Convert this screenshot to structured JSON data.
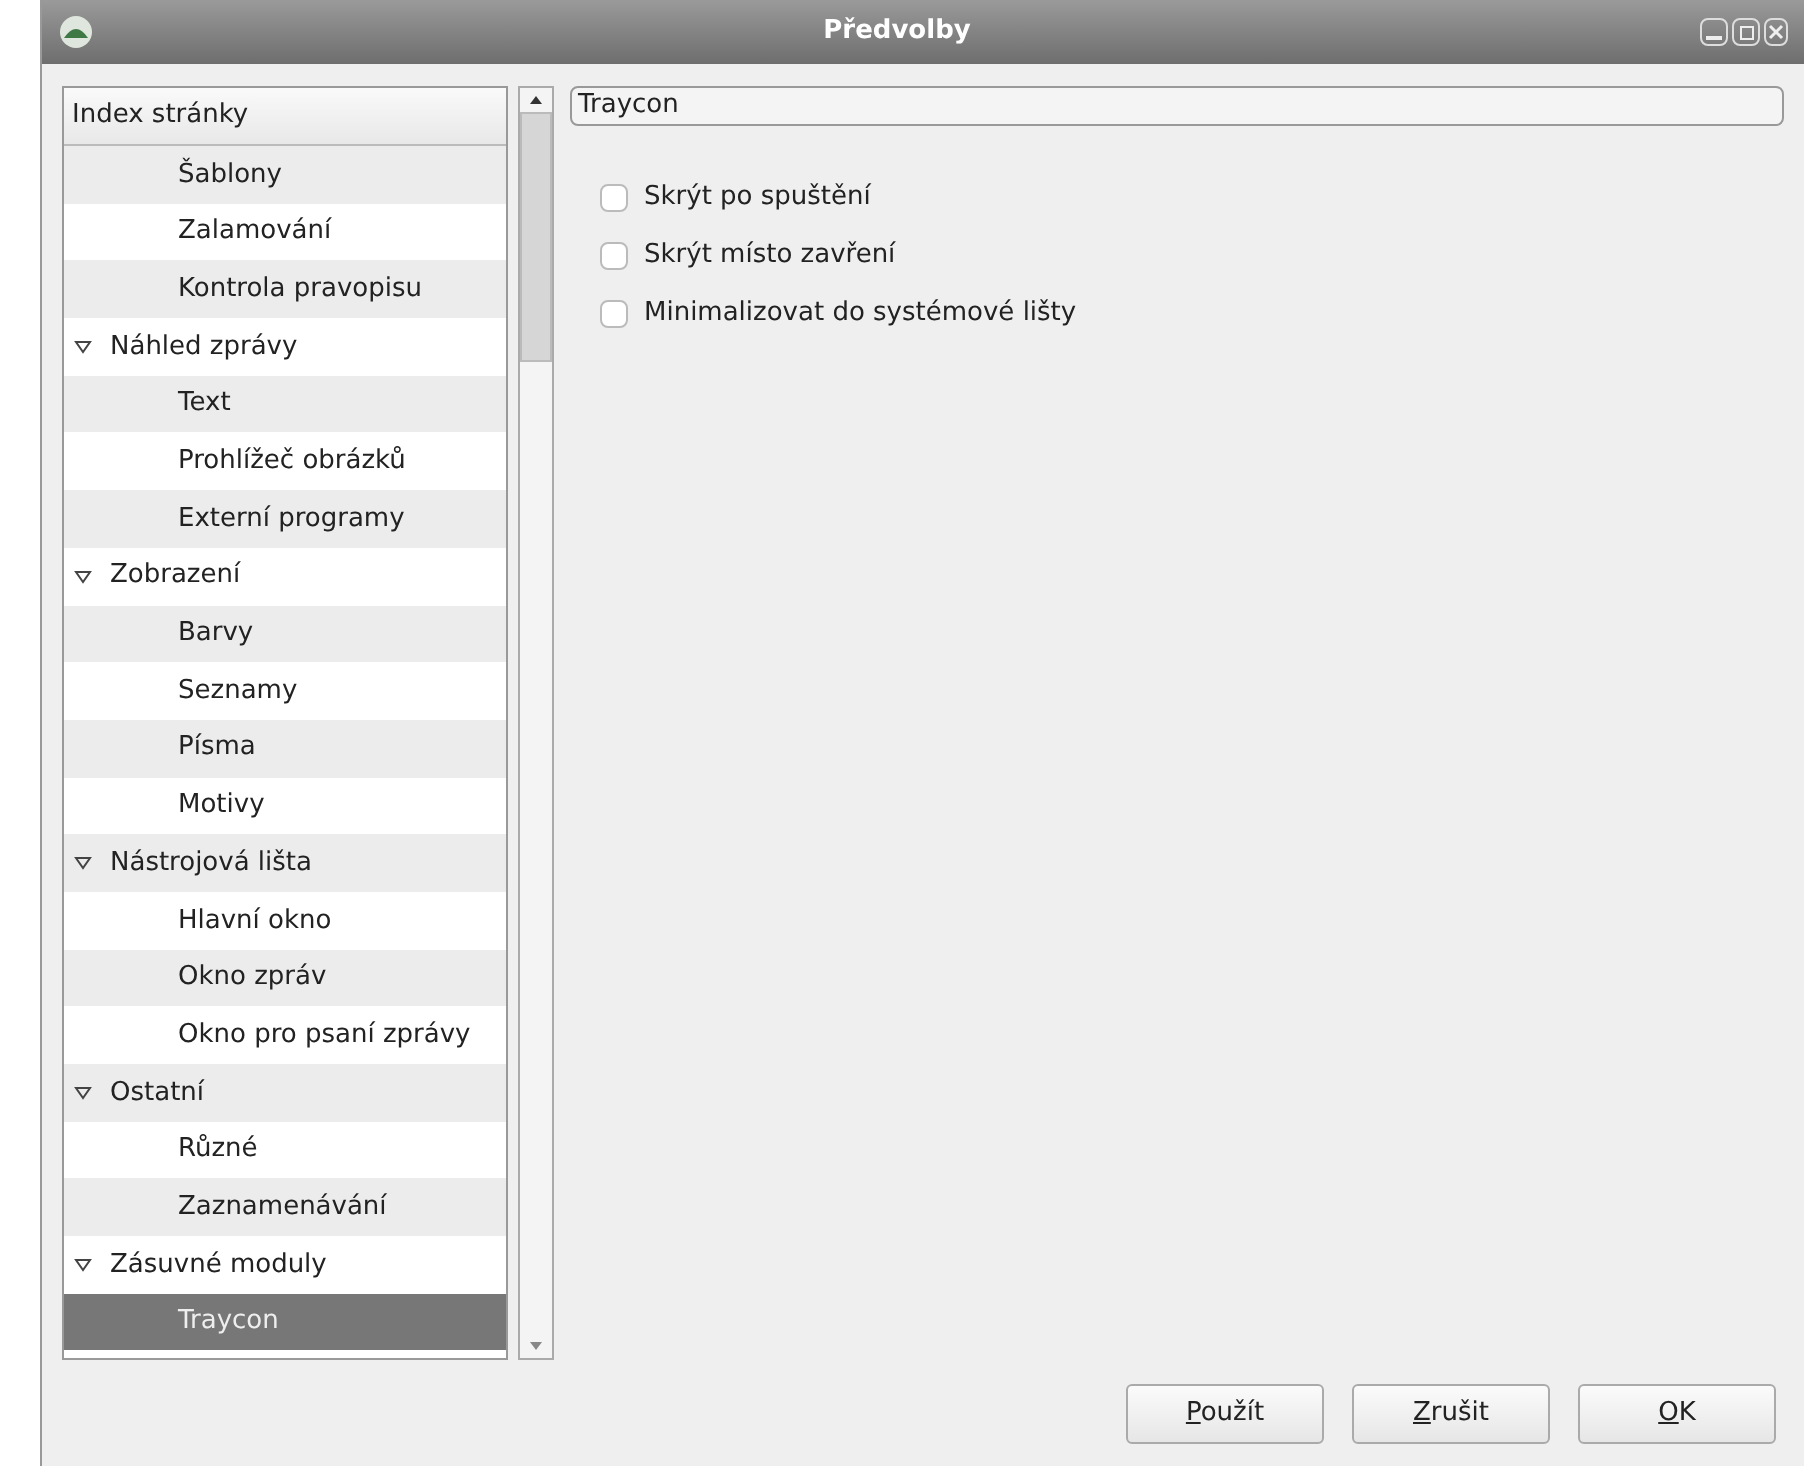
{
  "window": {
    "title": "Předvolby"
  },
  "sidebar": {
    "header": "Index stránky",
    "items": [
      {
        "children": [
          {
            "label": "Šablony",
            "selected": false
          },
          {
            "label": "Zalamování",
            "selected": false
          },
          {
            "label": "Kontrola pravopisu",
            "selected": false
          }
        ]
      },
      {
        "label": "Náhled zprávy",
        "expanded": true,
        "selected": false,
        "children": [
          {
            "label": "Text",
            "selected": false
          },
          {
            "label": "Prohlížeč obrázků",
            "selected": false
          },
          {
            "label": "Externí programy",
            "selected": false
          }
        ]
      },
      {
        "label": "Zobrazení",
        "expanded": true,
        "selected": false,
        "children": [
          {
            "label": "Barvy",
            "selected": false
          },
          {
            "label": "Seznamy",
            "selected": false
          },
          {
            "label": "Písma",
            "selected": false
          },
          {
            "label": "Motivy",
            "selected": false
          }
        ]
      },
      {
        "label": "Nástrojová lišta",
        "expanded": true,
        "selected": false,
        "children": [
          {
            "label": "Hlavní okno",
            "selected": false
          },
          {
            "label": "Okno zpráv",
            "selected": false
          },
          {
            "label": "Okno pro psaní zprávy",
            "selected": false
          }
        ]
      },
      {
        "label": "Ostatní",
        "expanded": true,
        "selected": false,
        "children": [
          {
            "label": "Různé",
            "selected": false
          },
          {
            "label": "Zaznamenávání",
            "selected": false
          }
        ]
      },
      {
        "label": "Zásuvné moduly",
        "expanded": true,
        "selected": false,
        "children": [
          {
            "label": "Traycon",
            "selected": true
          }
        ]
      }
    ]
  },
  "page": {
    "title": "Traycon",
    "options": [
      {
        "label": "Skrýt po spuštění",
        "checked": false
      },
      {
        "label": "Skrýt místo zavření",
        "checked": false
      },
      {
        "label": "Minimalizovat do systémové lišty",
        "checked": false
      }
    ]
  },
  "buttons": [
    "Použít",
    "Zrušit",
    "OK"
  ]
}
